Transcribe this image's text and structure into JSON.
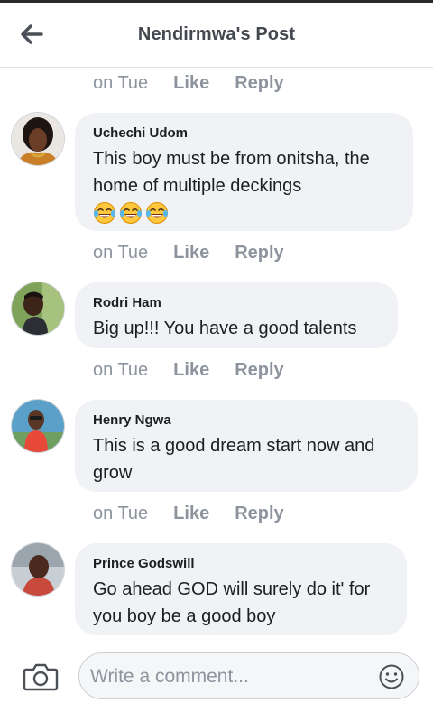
{
  "header": {
    "title": "Nendirmwa's Post",
    "back_icon": "back-arrow-icon"
  },
  "comments": [
    {
      "author": "Uchechi Udom",
      "text": "This boy must be from onitsha, the home of multiple deckings",
      "emojis": [
        "tears-of-joy-icon",
        "tears-of-joy-icon",
        "tears-of-joy-icon"
      ],
      "time": "on Tue",
      "like_label": "Like",
      "reply_label": "Reply"
    },
    {
      "author": "Rodri Ham",
      "text": "Big up!!! You have a good talents",
      "time": "on Tue",
      "like_label": "Like",
      "reply_label": "Reply"
    },
    {
      "author": "Henry Ngwa",
      "text": "This is a good dream start now and grow",
      "time": "on Tue",
      "like_label": "Like",
      "reply_label": "Reply"
    },
    {
      "author": "Prince Godswill",
      "text": "Go ahead GOD will surely do it' for you boy be a good boy"
    }
  ],
  "prev_comment_actions": {
    "time": "on Tue",
    "like_label": "Like",
    "reply_label": "Reply"
  },
  "composer": {
    "placeholder": "Write a comment...",
    "camera_icon": "camera-icon",
    "emoji_icon": "smiley-icon"
  },
  "colors": {
    "bubble": "#f0f2f5",
    "muted_text": "#8d949e",
    "header_text": "#444950"
  }
}
